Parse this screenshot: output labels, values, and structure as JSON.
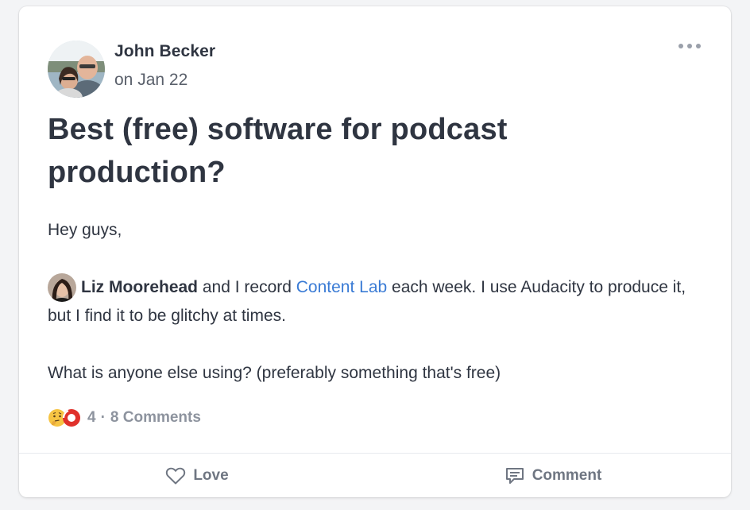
{
  "post": {
    "author": "John Becker",
    "date": "on Jan 22",
    "title": "Best (free) software for podcast production?",
    "body": {
      "greeting": "Hey guys,",
      "mention_name": "Liz Moorehead",
      "line2_part1": " and I record ",
      "link_text": "Content Lab",
      "line2_part2": " each week. I use Audacity to produce it, but I find it to be glitchy at times.",
      "line3": "What is anyone else using? (preferably something that's free)"
    },
    "reactions": {
      "icons": [
        "thinking-face-icon",
        "heart-icon"
      ],
      "count": "4",
      "separator": "·",
      "comments": "8 Comments"
    },
    "actions": {
      "love_label": "Love",
      "comment_label": "Comment"
    }
  },
  "colors": {
    "link": "#3a7bd5",
    "text": "#2f3541",
    "muted": "#8d939e",
    "reaction_heart": "#e0312b",
    "reaction_face": "#f6c443"
  }
}
